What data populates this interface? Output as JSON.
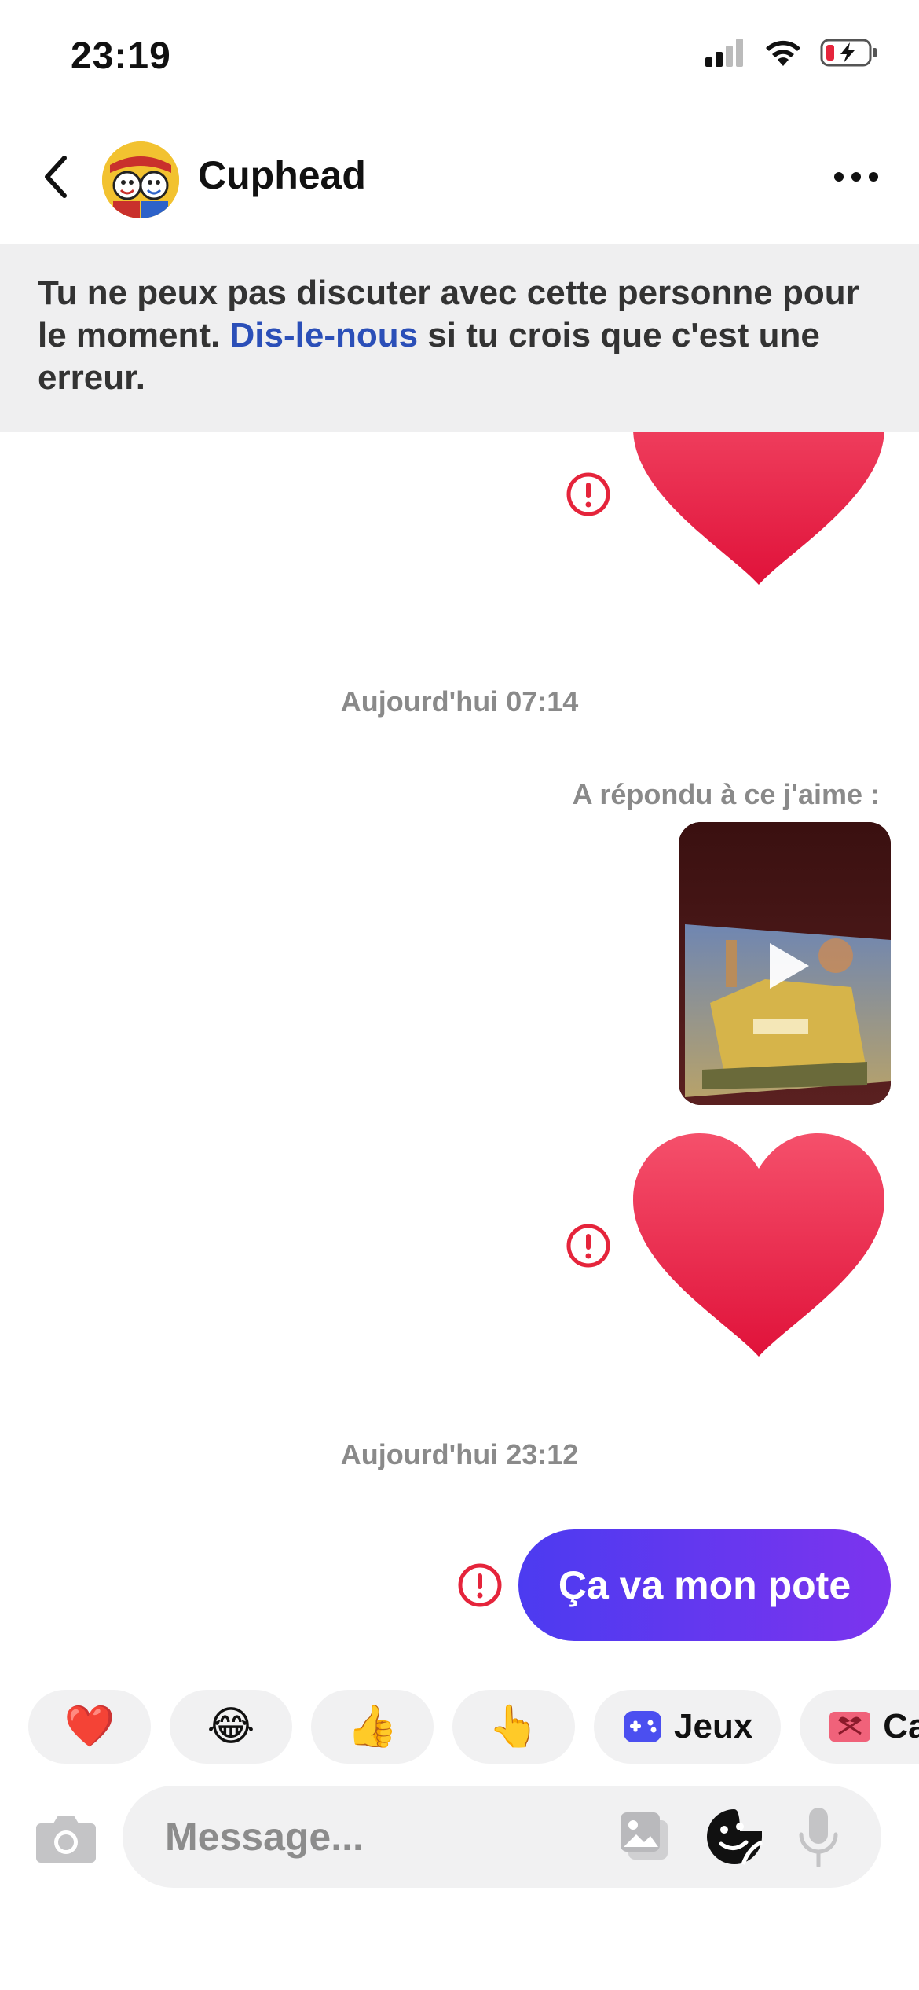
{
  "status_bar": {
    "time": "23:19",
    "icons": [
      "cellular-signal-icon",
      "wifi-icon",
      "battery-charging-icon"
    ],
    "battery_color": "#e5243b"
  },
  "header": {
    "back_icon": "chevron-left-icon",
    "contact_name": "Cuphead",
    "more_icon": "more-horizontal-icon"
  },
  "banner": {
    "text_before": "Tu ne peux pas discuter avec cette personne pour le moment. ",
    "link": "Dis-le-nous",
    "text_after": " si tu crois que c'est une erreur.",
    "link_color": "#2b4fb8"
  },
  "messages": [
    {
      "type": "heart",
      "status": "error-icon"
    },
    {
      "type": "timestamp",
      "text": "Aujourd'hui 07:14"
    },
    {
      "type": "reply-label",
      "text": "A répondu à ce j'aime :"
    },
    {
      "type": "video",
      "icon": "play-icon"
    },
    {
      "type": "heart",
      "status": "error-icon"
    },
    {
      "type": "timestamp",
      "text": "Aujourd'hui 23:12"
    },
    {
      "type": "text-bubble",
      "text": "Ça va mon pote",
      "status": "error-icon"
    }
  ],
  "timestamps": {
    "first": "Aujourd'hui 07:14",
    "second": "Aujourd'hui 23:12"
  },
  "reply_label": "A répondu à ce j'aime :",
  "bubble_text": "Ça va mon pote",
  "quick_replies": [
    {
      "emoji": "❤️",
      "label": ""
    },
    {
      "emoji": "😂",
      "label": ""
    },
    {
      "emoji": "👍",
      "label": ""
    },
    {
      "emoji": "👆",
      "label": ""
    },
    {
      "emoji": "game-controller-icon",
      "label": "Jeux"
    },
    {
      "emoji": "gift-icon",
      "label": "Ca"
    }
  ],
  "composer": {
    "placeholder": "Message...",
    "icons": [
      "camera-icon",
      "gallery-icon",
      "sticker-icon",
      "microphone-icon"
    ]
  },
  "colors": {
    "error": "#e5243b",
    "bubble_start": "#4c3bf0",
    "bubble_end": "#7c34ee",
    "heart": "#f0244a"
  }
}
